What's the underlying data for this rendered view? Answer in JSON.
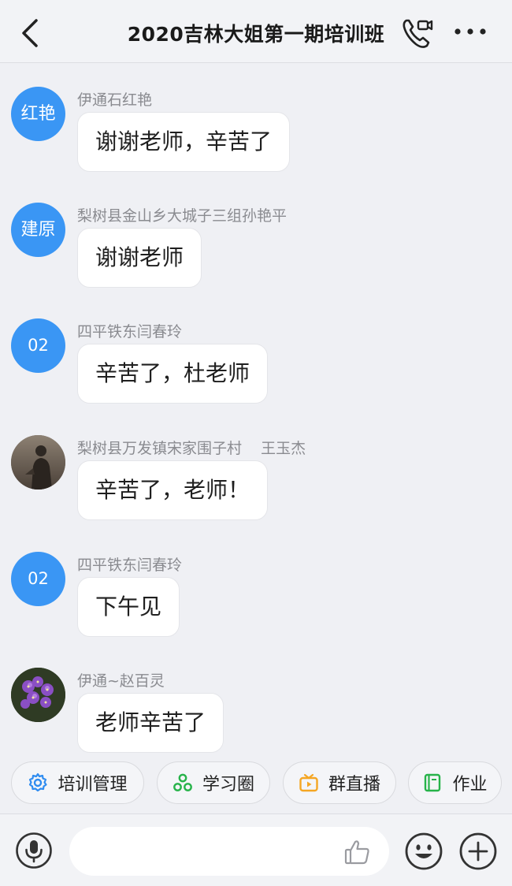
{
  "header": {
    "title": "2020吉林大姐第一期培训班",
    "back_icon": "chevron-left-icon",
    "call_icon": "video-call-icon",
    "more_icon": "more-dots-icon"
  },
  "messages": [
    {
      "avatar_text": "红艳",
      "sender": "伊通石红艳",
      "text": "谢谢老师，辛苦了"
    },
    {
      "avatar_text": "建原",
      "sender": "梨树县金山乡大城子三组孙艳平",
      "text": "谢谢老师"
    },
    {
      "avatar_text": "02",
      "sender": "四平铁东闫春玲",
      "text": "辛苦了，杜老师"
    },
    {
      "avatar_text": "",
      "sender": "梨树县万发镇宋家围子村    王玉杰",
      "text": "辛苦了，老师！"
    },
    {
      "avatar_text": "02",
      "sender": "四平铁东闫春玲",
      "text": "下午见"
    },
    {
      "avatar_text": "",
      "sender": "伊通~赵百灵",
      "text": "老师辛苦了"
    }
  ],
  "quick_actions": [
    {
      "label": "培训管理",
      "icon": "gear-icon",
      "color": "#2f8cf0"
    },
    {
      "label": "学习圈",
      "icon": "circles-icon",
      "color": "#27b34a"
    },
    {
      "label": "群直播",
      "icon": "tv-play-icon",
      "color": "#f5a623"
    },
    {
      "label": "作业",
      "icon": "book-icon",
      "color": "#27b34a"
    }
  ],
  "input": {
    "placeholder": "",
    "voice_icon": "microphone-icon",
    "like_icon": "thumbs-up-icon",
    "emoji_icon": "smiley-icon",
    "plus_icon": "plus-circle-icon"
  },
  "colors": {
    "accent": "#3a96f4",
    "background": "#eff0f4"
  }
}
